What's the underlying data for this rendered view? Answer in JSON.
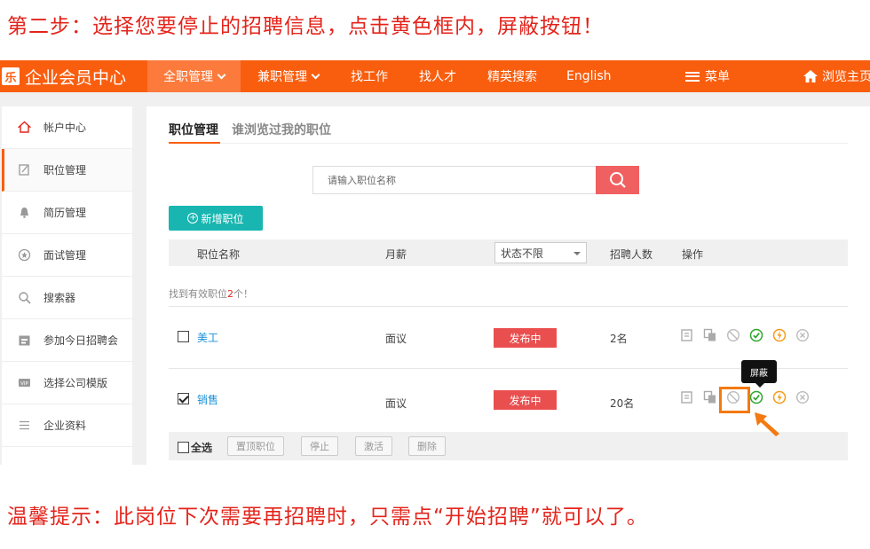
{
  "captions": {
    "top": "第二步：选择您要停止的招聘信息，点击黄色框内，屏蔽按钮！",
    "bottom": "温馨提示：此岗位下次需要再招聘时，只需点“开始招聘”就可以了。"
  },
  "brand": {
    "logo": "乐",
    "title": "企业会员中心"
  },
  "nav": {
    "items": [
      {
        "label": "全职管理",
        "dropdown": true,
        "active": true
      },
      {
        "label": "兼职管理",
        "dropdown": true
      },
      {
        "label": "找工作"
      },
      {
        "label": "找人才"
      },
      {
        "label": "精英搜索"
      },
      {
        "label": "English"
      }
    ],
    "menu": "菜单",
    "home": "浏览主页"
  },
  "sidebar": {
    "items": [
      {
        "label": "帐户中心",
        "icon": "home-icon"
      },
      {
        "label": "职位管理",
        "icon": "edit-icon",
        "active": true
      },
      {
        "label": "简历管理",
        "icon": "bell-icon"
      },
      {
        "label": "面试管理",
        "icon": "star-icon"
      },
      {
        "label": "搜索器",
        "icon": "search-icon"
      },
      {
        "label": "参加今日招聘会",
        "icon": "calendar-icon"
      },
      {
        "label": "选择公司模版",
        "icon": "vip-icon"
      },
      {
        "label": "企业资料",
        "icon": "list-icon"
      }
    ]
  },
  "tabs": {
    "manage": "职位管理",
    "viewed": "谁浏览过我的职位"
  },
  "search": {
    "placeholder": "请输入职位名称"
  },
  "add_button": "新增职位",
  "table": {
    "headers": {
      "name": "职位名称",
      "salary": "月薪",
      "status_filter": "状态不限",
      "count": "招聘人数",
      "ops": "操作"
    },
    "found_prefix": "找到有效职位",
    "found_count": "2",
    "found_suffix": "个！",
    "rows": [
      {
        "name": "美工",
        "salary": "面议",
        "status": "发布中",
        "count": "2名",
        "checked": false
      },
      {
        "name": "销售",
        "salary": "面议",
        "status": "发布中",
        "count": "20名",
        "checked": true
      }
    ]
  },
  "tooltip": "屏蔽",
  "bottom_bar": {
    "select_all": "全选",
    "buttons": [
      "置顶职位",
      "停止",
      "激活",
      "删除"
    ]
  },
  "colors": {
    "nav": "#f95e0f",
    "status": "#ea4f4f",
    "teal": "#19b6b1",
    "highlight": "#f37a10",
    "caption": "#e3241b"
  }
}
